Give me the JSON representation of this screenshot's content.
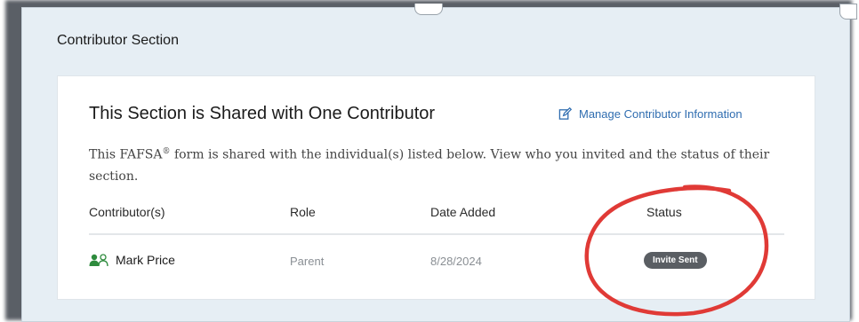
{
  "section": {
    "title": "Contributor Section"
  },
  "card": {
    "heading": "This Section is Shared with One Contributor",
    "manage_link": "Manage Contributor Information",
    "description_prefix": "This FAFSA",
    "description_sup": "®",
    "description_suffix": " form is shared with the individual(s) listed below. View who you invited and the status of their section."
  },
  "table": {
    "columns": [
      "Contributor(s)",
      "Role",
      "Date Added",
      "Status"
    ],
    "rows": [
      {
        "name": "Mark Price",
        "role": "Parent",
        "date_added": "8/28/2024",
        "status": "Invite Sent"
      }
    ]
  },
  "icons": {
    "contributor_icon": "people-icon",
    "manage_icon": "edit-icon"
  },
  "colors": {
    "link": "#2f6db0",
    "contributor_icon": "#2e8b3d",
    "status_badge": "#5a5e63",
    "annotation_circle": "#e03a36"
  }
}
